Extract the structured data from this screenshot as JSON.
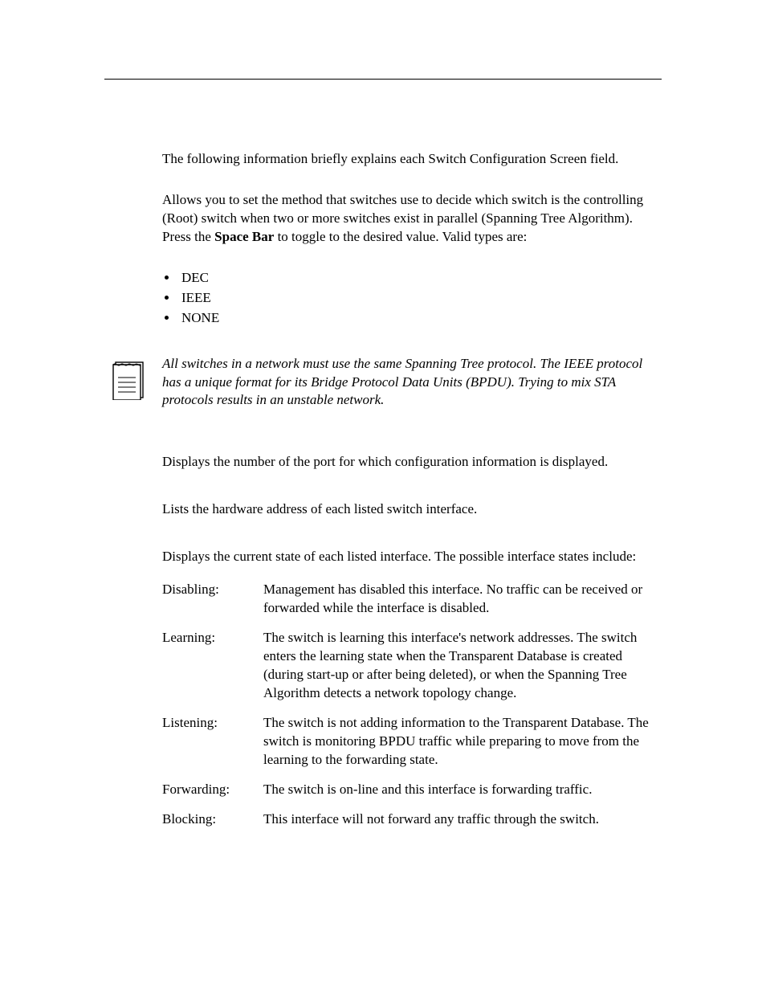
{
  "intro": "The following information briefly explains each Switch Configuration Screen field.",
  "sta_para_parts": {
    "before": "Allows you to set the method that switches use to decide which switch is the controlling (Root) switch when two or more switches exist in parallel (Spanning Tree Algorithm). Press the ",
    "bold": "Space Bar",
    "after": " to toggle to the desired value. Valid types are:"
  },
  "valid_types": [
    "DEC",
    "IEEE",
    "NONE"
  ],
  "note": "All switches in a network must use the same Spanning Tree protocol. The IEEE protocol has a unique format for its Bridge Protocol Data Units (BPDU). Trying to mix STA protocols results in an unstable network.",
  "port_number": "Displays the number of the port for which configuration information is displayed.",
  "hw_address": "Lists the hardware address of each listed switch interface.",
  "state_intro": "Displays the current state of each listed interface. The possible interface states include:",
  "states": [
    {
      "term": "Disabling:",
      "def": "Management has disabled this interface. No traffic can be received or forwarded while the interface is disabled."
    },
    {
      "term": "Learning:",
      "def": "The switch is learning this interface's network addresses. The switch enters the learning state when the Transparent Database is created (during start-up or after being deleted), or when the Spanning Tree Algorithm detects a network topology change."
    },
    {
      "term": "Listening:",
      "def": "The switch is not adding information to the Transparent Database. The switch is monitoring BPDU traffic while preparing to move from the learning to the forwarding state."
    },
    {
      "term": "Forwarding:",
      "def": "The switch is on-line and this interface is forwarding traffic."
    },
    {
      "term": "Blocking:",
      "def": "This interface will not forward any traffic through the switch."
    }
  ]
}
